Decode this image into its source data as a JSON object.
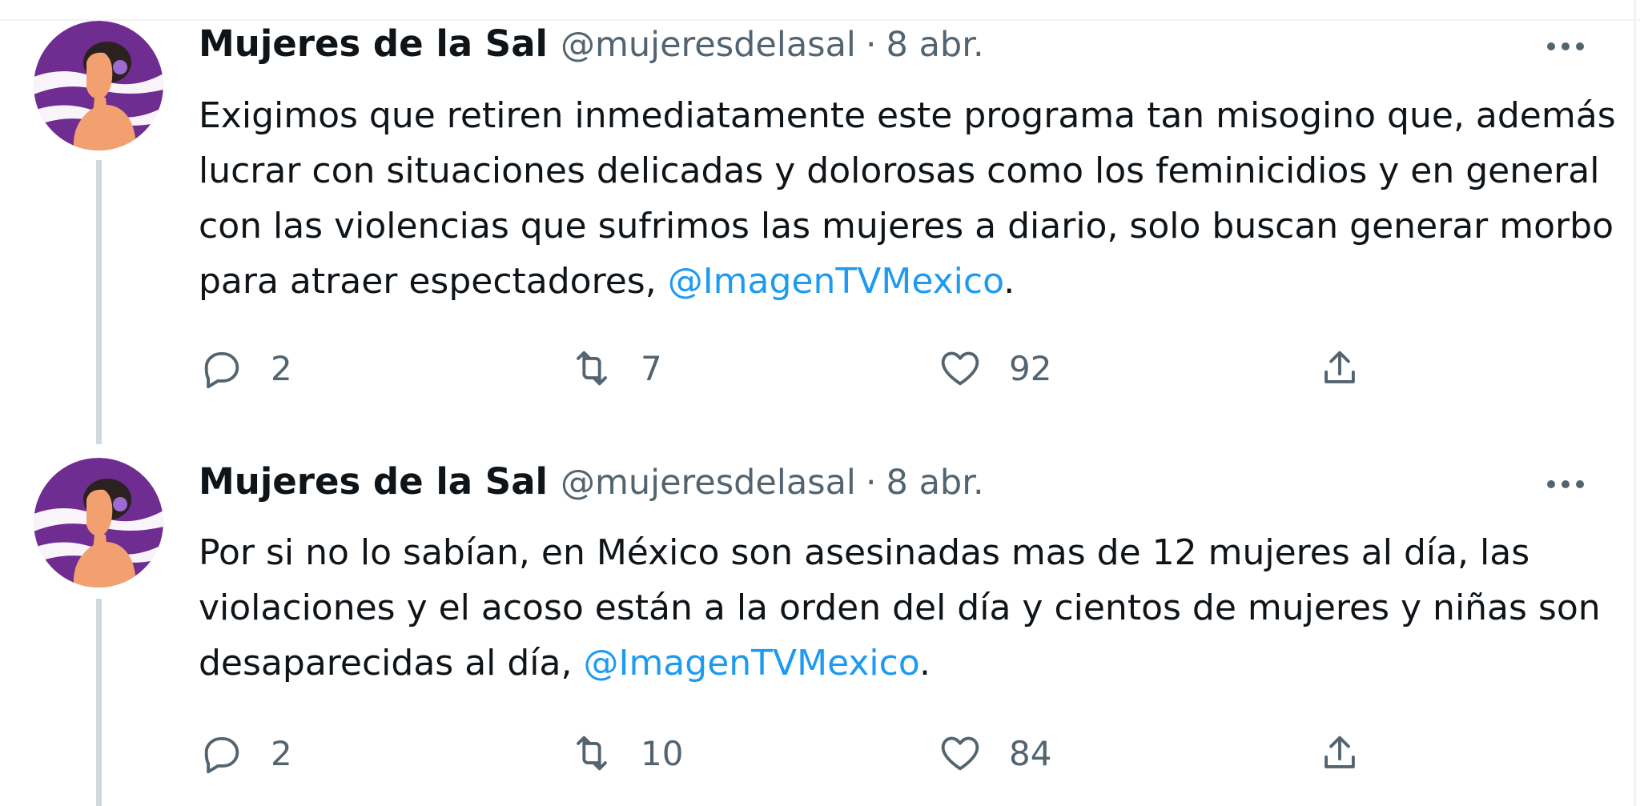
{
  "tweets": [
    {
      "author_name": "Mujeres de la Sal",
      "handle": "@mujeresdelasal",
      "separator": "·",
      "date": "8 abr.",
      "text": "Exigimos que retiren inmediatamente este programa tan misogino que, además lucrar con situaciones delicadas y dolorosas como los feminicidios y en general con las violencias que sufrimos las mujeres a diario, solo buscan generar morbo para atraer espectadores, ",
      "mention": "@ImagenTVMexico",
      "text_end": ".",
      "replies": "2",
      "retweets": "7",
      "likes": "92"
    },
    {
      "author_name": "Mujeres de la Sal",
      "handle": "@mujeresdelasal",
      "separator": "·",
      "date": "8 abr.",
      "text": "Por si no lo sabían, en México son asesinadas mas de 12 mujeres al día, las violaciones y el acoso están a la orden del día y cientos de mujeres y niñas son desaparecidas al día, ",
      "mention": "@ImagenTVMexico",
      "text_end": ".",
      "replies": "2",
      "retweets": "10",
      "likes": "84"
    }
  ],
  "icons": {
    "reply": "reply-icon",
    "retweet": "retweet-icon",
    "like": "heart-icon",
    "share": "share-icon",
    "more": "more-options-icon"
  },
  "colors": {
    "text": "#0f1419",
    "secondary": "#536471",
    "link": "#1d9bf0",
    "thread_line": "#cfd9de",
    "avatar_purple": "#6f2c91"
  }
}
